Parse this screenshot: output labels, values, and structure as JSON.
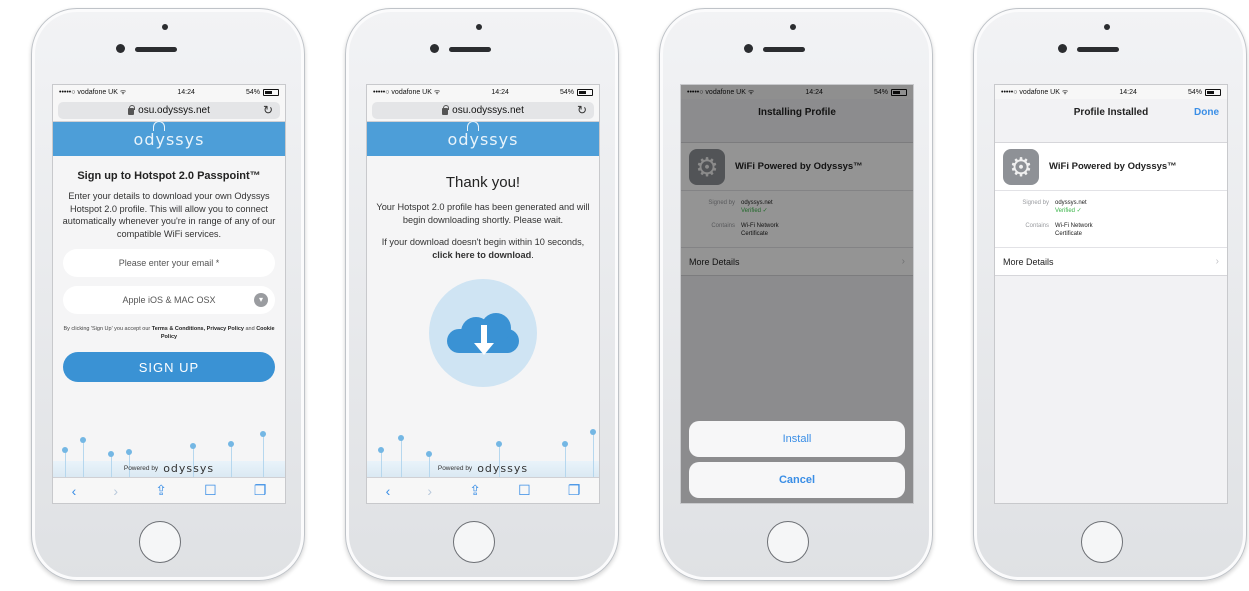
{
  "status_bar": {
    "carrier": "•••••○ vodafone UK ᯤ",
    "time": "14:24",
    "battery": "54%"
  },
  "browser": {
    "domain": "osu.odyssys.net"
  },
  "brand": {
    "logo_text": "odyssys"
  },
  "screen1": {
    "title": "Sign up to Hotspot 2.0 Passpoint™",
    "intro": "Enter your details to download your own Odyssys Hotspot 2.0 profile. This will allow you to connect automatically whenever you're in range of any of our compatible WiFi services.",
    "email_placeholder": "Please enter your email *",
    "device_select": "Apple iOS & MAC OSX",
    "terms_prefix": "By clicking 'Sign Up' you accept our ",
    "terms_link": "Terms & Conditions, Privacy Policy",
    "terms_and": " and ",
    "cookie_link": "Cookie Policy",
    "signup_button": "SIGN UP",
    "powered_by": "Powered by"
  },
  "screen2": {
    "title": "Thank you!",
    "message": "Your Hotspot 2.0 profile has been generated and will begin downloading shortly. Please wait.",
    "retry_prefix": "If your download doesn't begin within 10 seconds, ",
    "retry_link": "click here to download",
    "retry_suffix": ".",
    "powered_by": "Powered by"
  },
  "screen3": {
    "nav_title": "Installing Profile",
    "install_button": "Install",
    "cancel_button": "Cancel"
  },
  "screen4": {
    "nav_title": "Profile Installed",
    "done_button": "Done"
  },
  "profile": {
    "name": "WiFi Powered by Odyssys™",
    "signed_by_label": "Signed by",
    "signed_by_value": "odyssys.net",
    "verified": "Verified ✓",
    "contains_label": "Contains",
    "contains_value_1": "Wi-Fi Network",
    "contains_value_2": "Certificate",
    "more_details": "More Details"
  },
  "toolbar_icons": [
    "back-icon",
    "forward-icon",
    "share-icon",
    "bookmarks-icon",
    "tabs-icon"
  ],
  "colors": {
    "brand_blue": "#4d9ed8",
    "button_blue": "#3a92d4",
    "ios_blue": "#3a8ee6",
    "verified_green": "#3bb54a"
  }
}
